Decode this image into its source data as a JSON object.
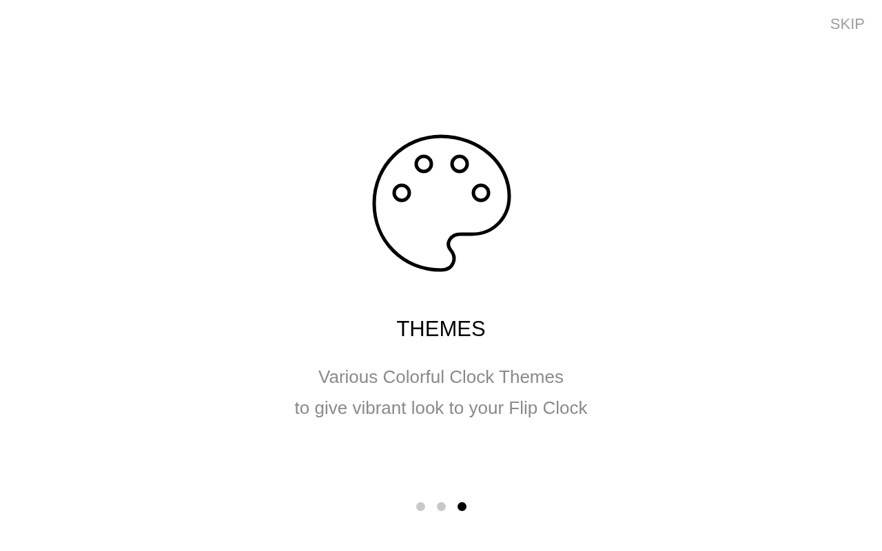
{
  "skip_button": {
    "label": "SKIP"
  },
  "slide": {
    "title": "THEMES",
    "description": [
      "Various Colorful Clock Themes",
      "to give vibrant look to your Flip Clock"
    ]
  },
  "pager": {
    "dots": [
      {
        "selected": false
      },
      {
        "selected": false
      },
      {
        "selected": true
      }
    ]
  }
}
